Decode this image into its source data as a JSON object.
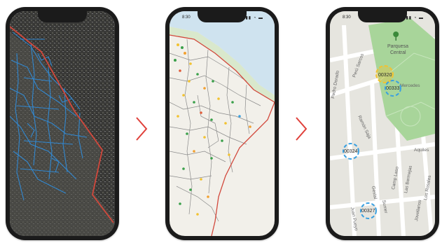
{
  "colors": {
    "accent": "#e0403a",
    "parcel_marker": "#3aa0e0",
    "selected_marker": "#f2c230",
    "park": "#a8d59a",
    "boundary": "#d2483c"
  },
  "phone_satellite": {
    "status_time": "",
    "status_icons": ""
  },
  "phone_overview": {
    "status_time": "8:30",
    "status_icons": "▮▮ ◔ ▬"
  },
  "phone_detail": {
    "status_time": "8:30",
    "status_icons": "▮▮ ◔ ▬",
    "park_label_line1": "Parquesa",
    "park_label_line2": "Central",
    "streets": {
      "s1": "Perú Sarcos",
      "s2": "Pedro Dorado",
      "s3": "Ramón Saja",
      "s4": "Mercedes",
      "s5": "Aquiles",
      "s6": "Gestal",
      "s7": "Camp Laso",
      "s8": "Las Bermejas",
      "s9": "Sumer",
      "s10": "Juan Pueyo",
      "s11": "Los Rosales",
      "s12": "Jovellanos"
    },
    "parcels": [
      {
        "id": "00320",
        "selected": true
      },
      {
        "id": "00333",
        "selected": false
      },
      {
        "id": "00324",
        "selected": false
      },
      {
        "id": "00327",
        "selected": false
      }
    ]
  },
  "icons": {
    "chevron_1": "chevron-right-icon",
    "chevron_2": "chevron-right-icon",
    "tree": "tree-icon"
  }
}
